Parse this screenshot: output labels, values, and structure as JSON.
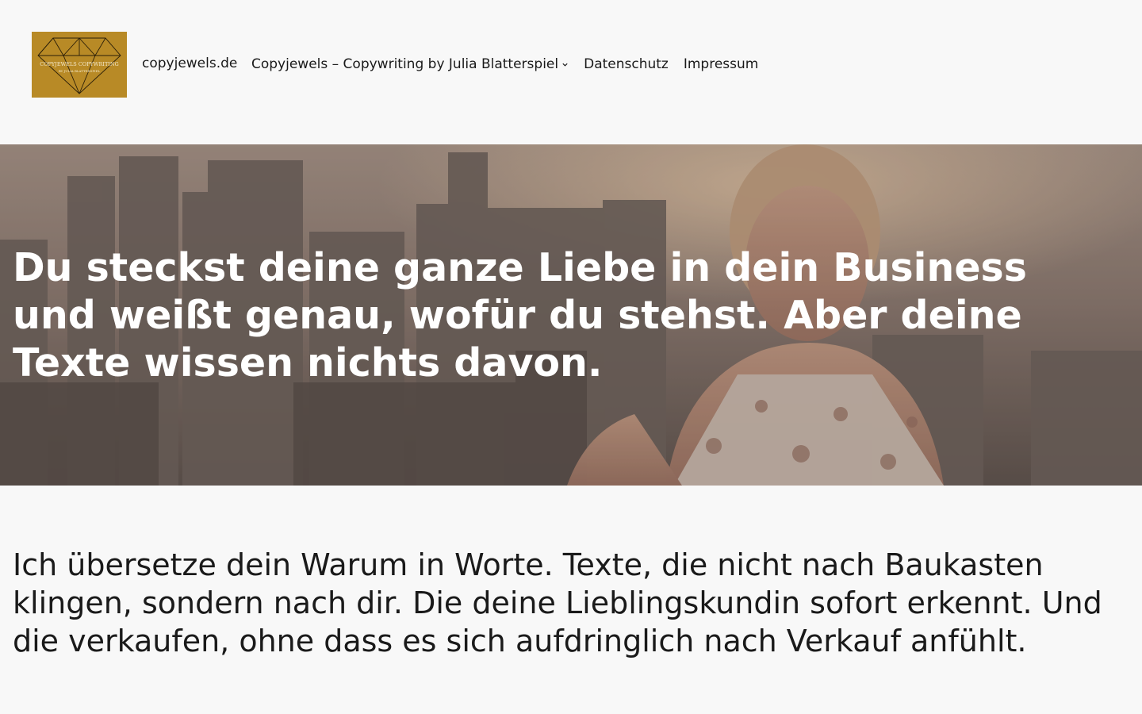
{
  "header": {
    "logo": {
      "text_line1": "COPYJEWELS  COPYWRITING",
      "text_line2": "BY JULIA BLATTERSPIEL",
      "background": "#b88a26"
    },
    "site_title": "copyjewels.de",
    "nav": [
      {
        "label": "Copyjewels – Copywriting by Julia Blatterspiel",
        "has_submenu": true,
        "icon": "chevron-down-icon"
      },
      {
        "label": "Datenschutz"
      },
      {
        "label": "Impressum"
      }
    ]
  },
  "hero": {
    "heading": "Du steckst deine ganze Liebe in dein Business und weißt genau, wofür du stehst. Aber deine Texte wissen nichts davon."
  },
  "intro": {
    "text": "Ich übersetze dein Warum in Worte. Texte, die nicht nach Baukasten klingen, sondern nach dir. Die deine Lieblingskundin sofort erkennt. Und die verkaufen, ohne dass es sich aufdringlich nach Verkauf anfühlt."
  },
  "colors": {
    "page_background": "#f8f8f8",
    "text": "#1a1a1a",
    "hero_text": "#ffffff",
    "logo_gold": "#b88a26"
  }
}
